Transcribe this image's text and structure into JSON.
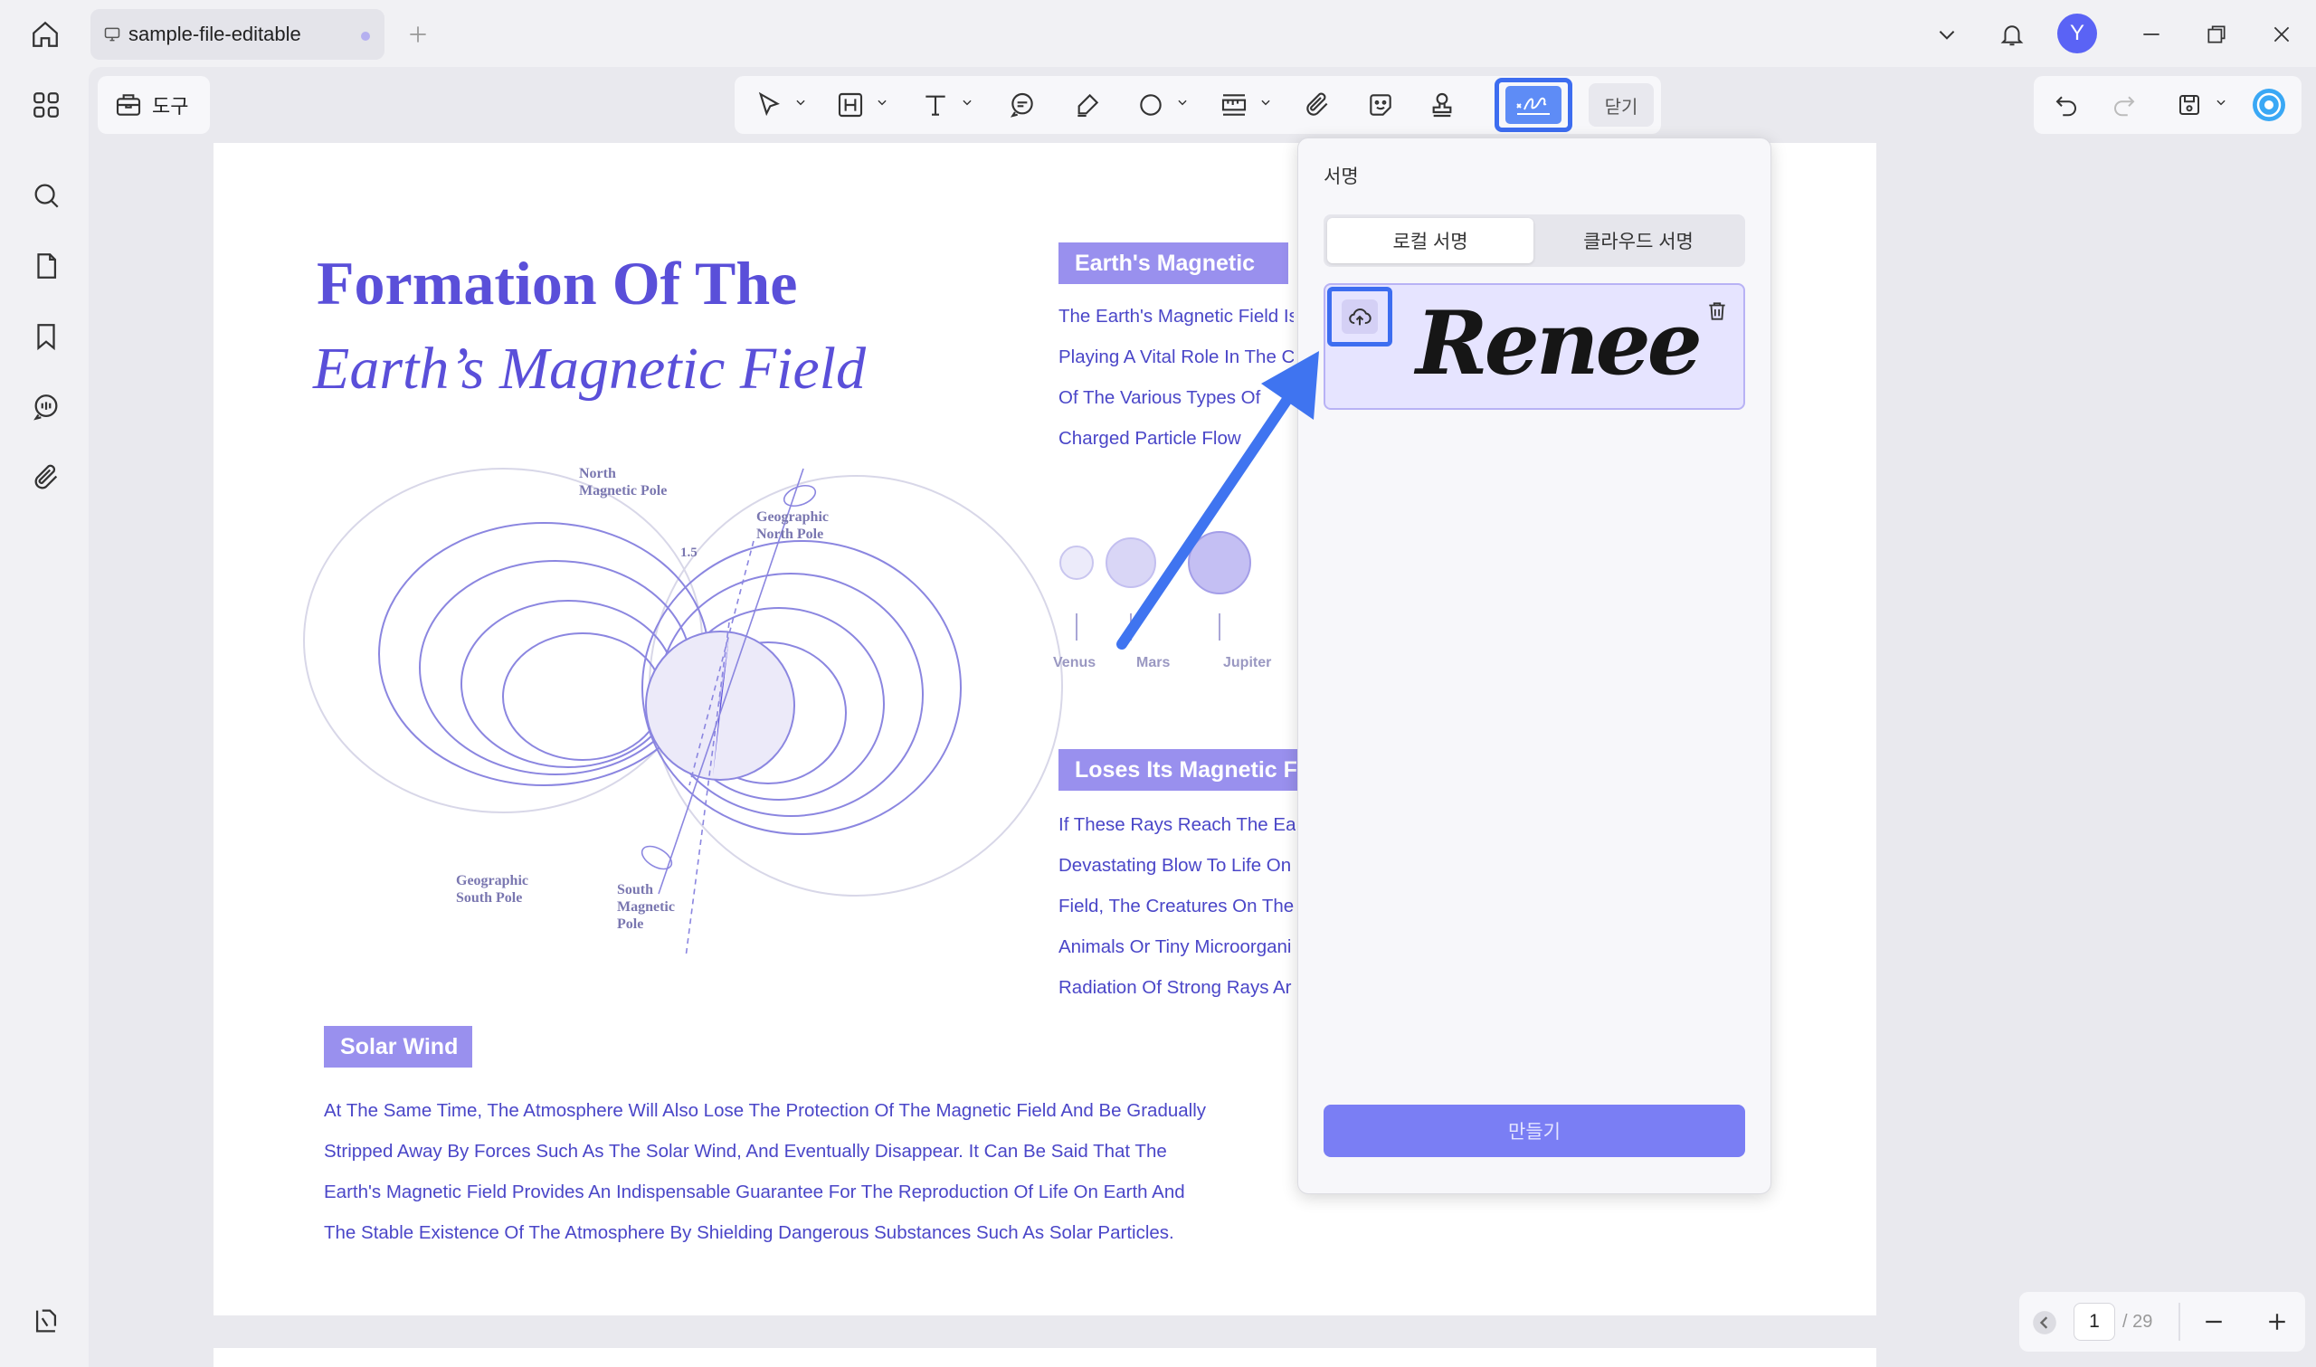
{
  "titlebar": {
    "tab_title": "sample-file-editable",
    "avatar_initial": "Y",
    "icons": [
      "home-icon",
      "monitor-icon",
      "add-tab-icon",
      "chevron-down-icon",
      "bell-icon",
      "minimize-icon",
      "restore-icon",
      "close-icon"
    ]
  },
  "sidebar": {
    "icons": [
      "thumbnails-icon",
      "search-icon",
      "pages-icon",
      "bookmark-icon",
      "comment-icon",
      "attachment-icon",
      "sidebar-toggle-icon"
    ]
  },
  "toolbar": {
    "tools_label": "도구",
    "close_label": "닫기",
    "tool_icons": [
      "select-icon",
      "text-box-icon",
      "text-icon",
      "comment-icon",
      "highlighter-icon",
      "shape-icon",
      "measure-icon",
      "attach-icon",
      "sticker-icon",
      "stamp-icon",
      "signature-icon"
    ]
  },
  "right_tools": {
    "icons": [
      "undo-icon",
      "redo-icon",
      "save-icon",
      "ai-assistant-icon"
    ]
  },
  "document": {
    "title_line1": "Formation Of The",
    "title_line2": "Earth’s Magnetic Field",
    "section_magnetic": "Earth's Magnetic",
    "magnetic_lines": [
      "The Earth's Magnetic Field Is",
      "Playing A Vital Role In The C",
      "Of The Various Types Of",
      "Charged Particle Flow"
    ],
    "section_loses": "Loses Its Magnetic Fie",
    "loses_lines": [
      "If These Rays Reach The Ea",
      "Devastating Blow To Life On",
      "Field, The Creatures On The",
      "Animals Or Tiny Microorgani",
      "Radiation Of Strong Rays Ar"
    ],
    "section_solar": "Solar Wind",
    "solar_lines": [
      "At The Same Time, The Atmosphere Will Also Lose The Protection Of The Magnetic Field And Be Gradually",
      "Stripped Away By Forces Such As The Solar Wind, And Eventually Disappear. It Can Be Said That The",
      "Earth's Magnetic Field Provides An Indispensable Guarantee For The Reproduction Of Life On Earth And",
      "The Stable Existence Of The Atmosphere By Shielding Dangerous Substances Such As Solar Particles."
    ],
    "diagram": {
      "north_magnetic": [
        "North",
        "Magnetic Pole"
      ],
      "geo_north": [
        "Geographic",
        "North Pole"
      ],
      "geo_south": [
        "Geographic",
        "South Pole"
      ],
      "south_magnetic": [
        "South",
        "Magnetic",
        "Pole"
      ],
      "tilt": "1.5"
    },
    "planets": [
      "Venus",
      "Mars",
      "Jupiter"
    ]
  },
  "signature_panel": {
    "title": "서명",
    "tab_local": "로컬 서명",
    "tab_cloud": "클라우드 서명",
    "signature_text": "Renee",
    "create_label": "만들기"
  },
  "page_nav": {
    "current": "1",
    "total": "/ 29"
  },
  "colors": {
    "accent": "#3d6df0",
    "doc_purple": "#5a4fd9",
    "tag_purple": "#9990ee",
    "create_button": "#7a7ef4"
  }
}
